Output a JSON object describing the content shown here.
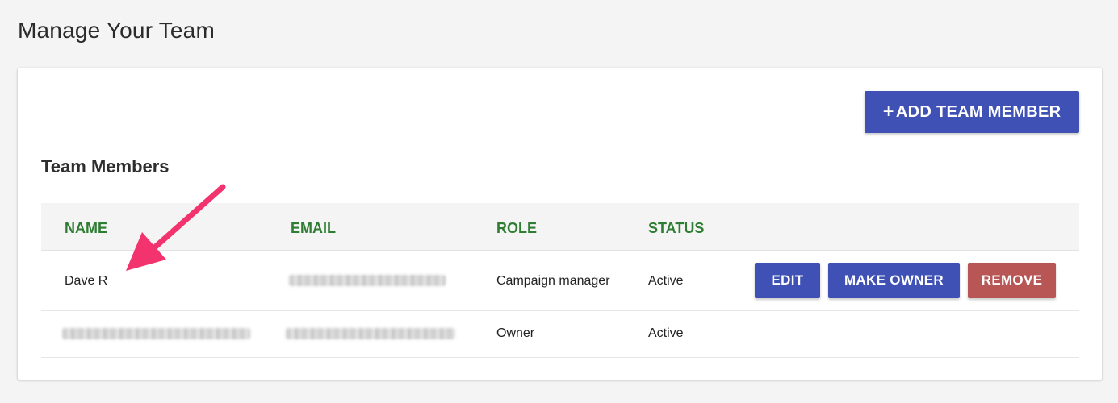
{
  "page": {
    "title": "Manage Your Team"
  },
  "toolbar": {
    "add_button_icon": "+",
    "add_button_label": "ADD TEAM MEMBER"
  },
  "section": {
    "title": "Team Members"
  },
  "table": {
    "columns": [
      "NAME",
      "EMAIL",
      "ROLE",
      "STATUS"
    ],
    "rows": [
      {
        "name": "Dave R",
        "email": "[redacted]",
        "role": "Campaign manager",
        "status": "Active",
        "actions": [
          "EDIT",
          "MAKE OWNER",
          "REMOVE"
        ]
      },
      {
        "name": "[redacted]",
        "email": "[redacted]",
        "role": "Owner",
        "status": "Active",
        "actions": []
      }
    ]
  },
  "colors": {
    "primary": "#3f51b5",
    "danger": "#b85656",
    "header_text": "#2e7d32",
    "annotation_arrow": "#f2336e"
  },
  "icons": {
    "add": "plus-icon",
    "annotation": "pink-arrow-icon"
  }
}
